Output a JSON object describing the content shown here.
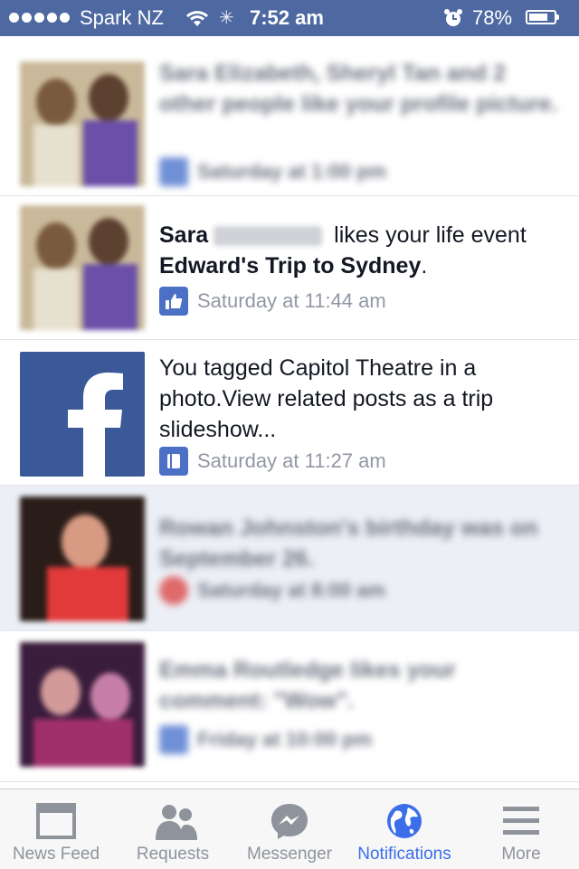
{
  "status_bar": {
    "carrier": "Spark NZ",
    "time": "7:52 am",
    "battery_percent": "78%",
    "battery_level": 0.78
  },
  "notifications": [
    {
      "blurred": true,
      "text": "Sara Elizabeth, Sheryl Tan and 2 other people like your profile picture.",
      "time": "Saturday at 1:00 pm",
      "icon": "like-icon"
    },
    {
      "actor": "Sara",
      "pre": "likes your life event",
      "object": "Edward's Trip to Sydney",
      "post": ".",
      "time": "Saturday at 11:44 am",
      "icon": "like-icon"
    },
    {
      "text": "You tagged Capitol Theatre in a photo.View related posts as a trip slideshow...",
      "time": "Saturday at 11:27 am",
      "icon": "album-icon"
    },
    {
      "blurred": true,
      "unread": true,
      "text": "Rowan Johnston's birthday was on September 26.",
      "time": "Saturday at 8:00 am",
      "icon": "birthday-icon"
    },
    {
      "blurred": true,
      "text": "Emma Routledge likes your comment: \"Wow\".",
      "time": "Friday at 10:00 pm",
      "icon": "like-icon"
    }
  ],
  "tabs": [
    {
      "label": "News Feed",
      "icon": "news-feed-icon",
      "active": false
    },
    {
      "label": "Requests",
      "icon": "friend-requests-icon",
      "active": false
    },
    {
      "label": "Messenger",
      "icon": "messenger-icon",
      "active": false
    },
    {
      "label": "Notifications",
      "icon": "globe-icon",
      "active": true
    },
    {
      "label": "More",
      "icon": "menu-icon",
      "active": false
    }
  ],
  "colors": {
    "status_bar": "#4e69a2",
    "active_tab": "#3b6ee8",
    "facebook_blue": "#3b5998",
    "unread_bg": "#eceff5"
  }
}
